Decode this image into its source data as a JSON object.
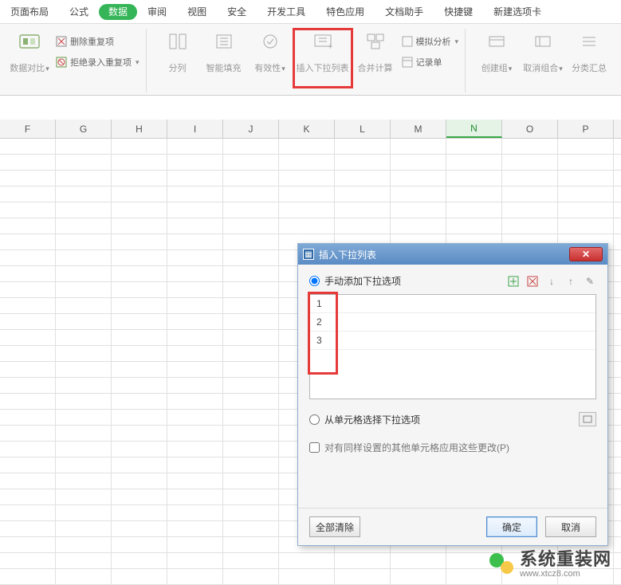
{
  "menu": {
    "tabs": [
      "页面布局",
      "公式",
      "数据",
      "审阅",
      "视图",
      "安全",
      "开发工具",
      "特色应用",
      "文档助手",
      "快捷键",
      "新建选项卡"
    ],
    "active_index": 2
  },
  "ribbon": {
    "data_compare": "数据对比",
    "del_dup": "删除重复项",
    "reject_dup": "拒绝录入重复项",
    "split_cols": "分列",
    "smart_fill": "智能填充",
    "validation": "有效性",
    "insert_dropdown": "插入下拉列表",
    "consolidate": "合并计算",
    "sim_analysis": "模拟分析",
    "record_form": "记录单",
    "create_group": "创建组",
    "ungroup": "取消组合",
    "subtotal": "分类汇总"
  },
  "columns": [
    "F",
    "G",
    "H",
    "I",
    "J",
    "K",
    "L",
    "M",
    "N",
    "O",
    "P"
  ],
  "selected_col": "N",
  "dialog": {
    "title": "插入下拉列表",
    "opt_manual": "手动添加下拉选项",
    "list_items": [
      "1",
      "2",
      "3"
    ],
    "opt_range": "从单元格选择下拉选项",
    "apply_same": "对有同样设置的其他单元格应用这些更改(P)",
    "clear_all": "全部清除",
    "ok": "确定",
    "cancel": "取消"
  },
  "watermark": {
    "title": "系统重装网",
    "url": "www.xtcz8.com"
  }
}
